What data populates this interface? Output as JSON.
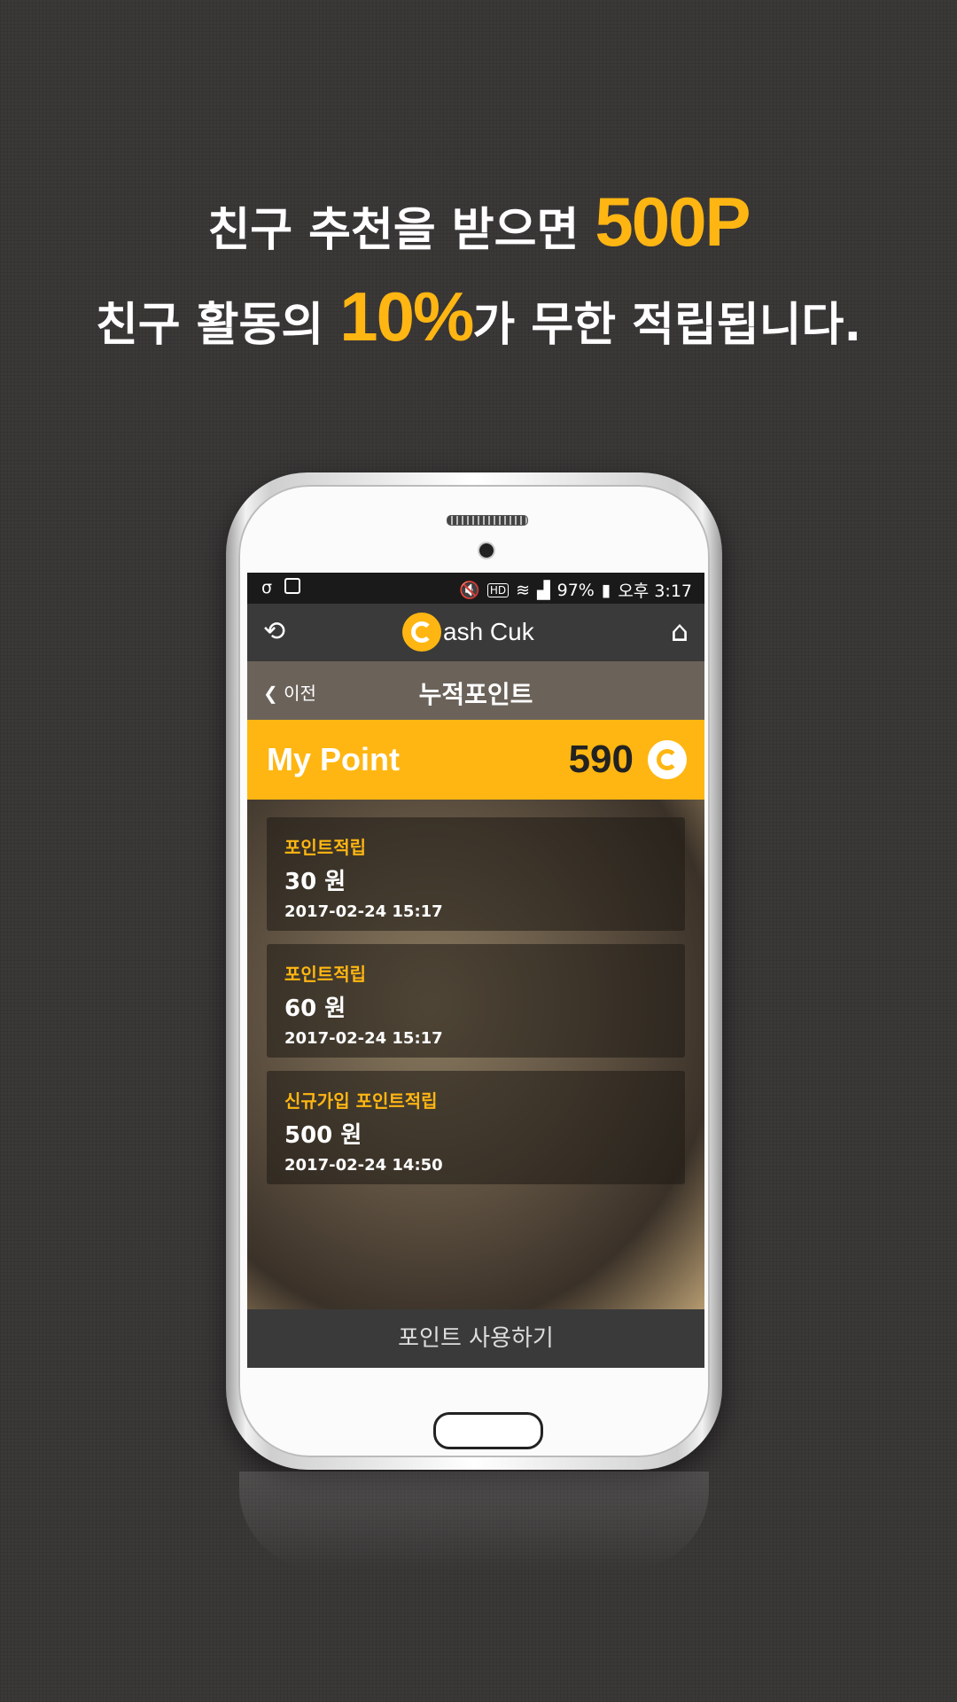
{
  "promo": {
    "line1_prefix": "친구 추천을 받으면 ",
    "line1_highlight": "500P",
    "line2_prefix": "친구 활동의 ",
    "line2_highlight": "10%",
    "line2_suffix": "가 무한 적립됩니다.",
    "highlight_color": "#ffb612"
  },
  "statusbar": {
    "battery": "97%",
    "time": "오후 3:17",
    "hd_label": "HD"
  },
  "appbar": {
    "logo_text": "ash Cuk",
    "left_icon": "sync-icon",
    "right_icon": "home-icon"
  },
  "subbar": {
    "back_label": "이전",
    "title": "누적포인트"
  },
  "my_point": {
    "label": "My Point",
    "value": "590"
  },
  "history": [
    {
      "type": "포인트적립",
      "amount": "30 원",
      "date": "2017-02-24 15:17"
    },
    {
      "type": "포인트적립",
      "amount": "60 원",
      "date": "2017-02-24 15:17"
    },
    {
      "type": "신규가입 포인트적립",
      "amount": "500 원",
      "date": "2017-02-24 14:50"
    }
  ],
  "bottom_button": "포인트 사용하기",
  "colors": {
    "accent": "#ffb612",
    "appbar": "#3a3a3a"
  }
}
